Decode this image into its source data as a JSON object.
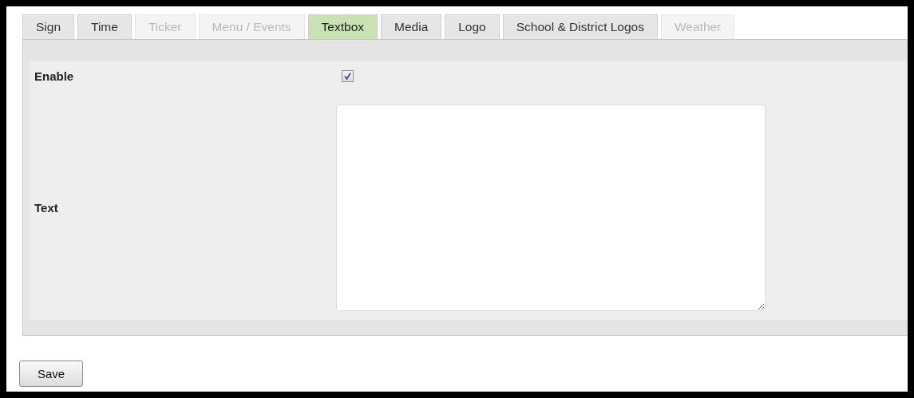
{
  "tabs": [
    {
      "label": "Sign",
      "selected": false,
      "disabled": false
    },
    {
      "label": "Time",
      "selected": false,
      "disabled": false
    },
    {
      "label": "Ticker",
      "selected": false,
      "disabled": true
    },
    {
      "label": "Menu / Events",
      "selected": false,
      "disabled": true
    },
    {
      "label": "Textbox",
      "selected": true,
      "disabled": false
    },
    {
      "label": "Media",
      "selected": false,
      "disabled": false
    },
    {
      "label": "Logo",
      "selected": false,
      "disabled": false
    },
    {
      "label": "School & District Logos",
      "selected": false,
      "disabled": false
    },
    {
      "label": "Weather",
      "selected": false,
      "disabled": true
    }
  ],
  "enable": {
    "label": "Enable",
    "checked": true
  },
  "text": {
    "label": "Text"
  },
  "save_button": {
    "label": "Save"
  }
}
